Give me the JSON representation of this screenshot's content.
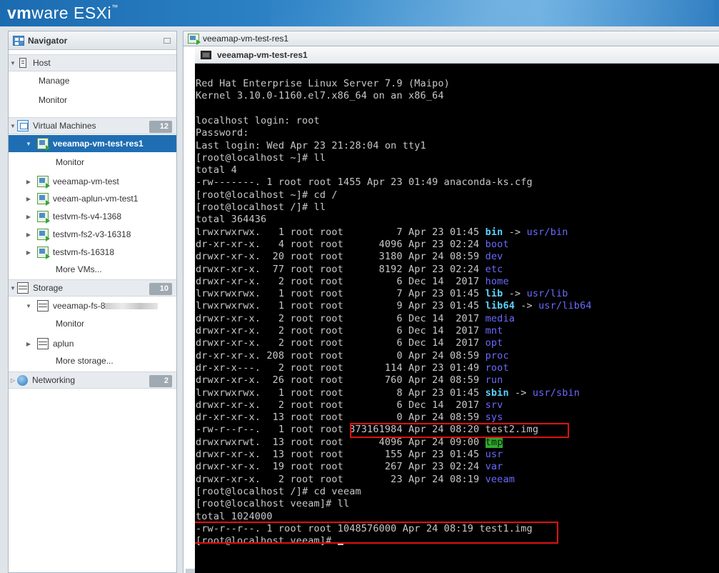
{
  "app": {
    "brand_vm": "vm",
    "brand_ware": "ware",
    "brand_product": " ESXi",
    "brand_tm": "™"
  },
  "navigator": {
    "title": "Navigator",
    "host": {
      "label": "Host",
      "children": [
        "Manage",
        "Monitor"
      ]
    },
    "virtual_machines": {
      "label": "Virtual Machines",
      "count": "12",
      "selected": "veeamap-vm-test-res1",
      "selected_child": "Monitor",
      "items": [
        "veeamap-vm-test",
        "veeam-aplun-vm-test1",
        "testvm-fs-v4-1368",
        "testvm-fs2-v3-16318",
        "testvm-fs-16318"
      ],
      "more": "More VMs..."
    },
    "storage": {
      "label": "Storage",
      "count": "10",
      "items": [
        {
          "label": "veeamap-fs-8",
          "child": "Monitor"
        },
        {
          "label": "aplun"
        }
      ],
      "more": "More storage..."
    },
    "networking": {
      "label": "Networking",
      "count": "2"
    }
  },
  "tab": {
    "label": "veeamap-vm-test-res1"
  },
  "console": {
    "title": "veeamap-vm-test-res1",
    "lines": [
      "Red Hat Enterprise Linux Server 7.9 (Maipo)",
      "Kernel 3.10.0-1160.el7.x86_64 on an x86_64",
      "",
      "localhost login: root",
      "Password:",
      "Last login: Wed Apr 23 21:28:04 on tty1",
      "[root@localhost ~]# ll",
      "total 4",
      "-rw-------. 1 root root 1455 Apr 23 01:49 anaconda-ks.cfg",
      "[root@localhost ~]# cd /",
      "[root@localhost /]# ll",
      "total 364436"
    ],
    "listing": [
      {
        "perm": "lrwxrwxrwx.",
        "links": "1",
        "size": "7",
        "date": "Apr 23 01:45",
        "name": "bin",
        "type": "link",
        "target": "usr/bin"
      },
      {
        "perm": "dr-xr-xr-x.",
        "links": "4",
        "size": "4096",
        "date": "Apr 23 02:24",
        "name": "boot",
        "type": "dir"
      },
      {
        "perm": "drwxr-xr-x.",
        "links": "20",
        "size": "3180",
        "date": "Apr 24 08:59",
        "name": "dev",
        "type": "dir"
      },
      {
        "perm": "drwxr-xr-x.",
        "links": "77",
        "size": "8192",
        "date": "Apr 23 02:24",
        "name": "etc",
        "type": "dir"
      },
      {
        "perm": "drwxr-xr-x.",
        "links": "2",
        "size": "6",
        "date": "Dec 14  2017",
        "name": "home",
        "type": "dir"
      },
      {
        "perm": "lrwxrwxrwx.",
        "links": "1",
        "size": "7",
        "date": "Apr 23 01:45",
        "name": "lib",
        "type": "link",
        "target": "usr/lib"
      },
      {
        "perm": "lrwxrwxrwx.",
        "links": "1",
        "size": "9",
        "date": "Apr 23 01:45",
        "name": "lib64",
        "type": "link",
        "target": "usr/lib64"
      },
      {
        "perm": "drwxr-xr-x.",
        "links": "2",
        "size": "6",
        "date": "Dec 14  2017",
        "name": "media",
        "type": "dir"
      },
      {
        "perm": "drwxr-xr-x.",
        "links": "2",
        "size": "6",
        "date": "Dec 14  2017",
        "name": "mnt",
        "type": "dir"
      },
      {
        "perm": "drwxr-xr-x.",
        "links": "2",
        "size": "6",
        "date": "Dec 14  2017",
        "name": "opt",
        "type": "dir"
      },
      {
        "perm": "dr-xr-xr-x.",
        "links": "208",
        "size": "0",
        "date": "Apr 24 08:59",
        "name": "proc",
        "type": "dir"
      },
      {
        "perm": "dr-xr-x---.",
        "links": "2",
        "size": "114",
        "date": "Apr 23 01:49",
        "name": "root",
        "type": "dir"
      },
      {
        "perm": "drwxr-xr-x.",
        "links": "26",
        "size": "760",
        "date": "Apr 24 08:59",
        "name": "run",
        "type": "dir"
      },
      {
        "perm": "lrwxrwxrwx.",
        "links": "1",
        "size": "8",
        "date": "Apr 23 01:45",
        "name": "sbin",
        "type": "link",
        "target": "usr/sbin"
      },
      {
        "perm": "drwxr-xr-x.",
        "links": "2",
        "size": "6",
        "date": "Dec 14  2017",
        "name": "srv",
        "type": "dir"
      },
      {
        "perm": "dr-xr-xr-x.",
        "links": "13",
        "size": "0",
        "date": "Apr 24 08:59",
        "name": "sys",
        "type": "dir"
      },
      {
        "perm": "-rw-r--r--.",
        "links": "1",
        "size": "373161984",
        "date": "Apr 24 08:20",
        "name": "test2.img",
        "type": "file"
      },
      {
        "perm": "drwxrwxrwt.",
        "links": "13",
        "size": "4096",
        "date": "Apr 24 09:00",
        "name": "tmp",
        "type": "sticky"
      },
      {
        "perm": "drwxr-xr-x.",
        "links": "13",
        "size": "155",
        "date": "Apr 23 01:45",
        "name": "usr",
        "type": "dir"
      },
      {
        "perm": "drwxr-xr-x.",
        "links": "19",
        "size": "267",
        "date": "Apr 23 02:24",
        "name": "var",
        "type": "dir"
      },
      {
        "perm": "drwxr-xr-x.",
        "links": "2",
        "size": "23",
        "date": "Apr 24 08:19",
        "name": "veeam",
        "type": "dir"
      }
    ],
    "tail": [
      "[root@localhost /]# cd veeam",
      "[root@localhost veeam]# ll",
      "total 1024000",
      "-rw-r--r--. 1 root root 1048576000 Apr 24 08:19 test1.img",
      "[root@localhost veeam]# "
    ]
  }
}
